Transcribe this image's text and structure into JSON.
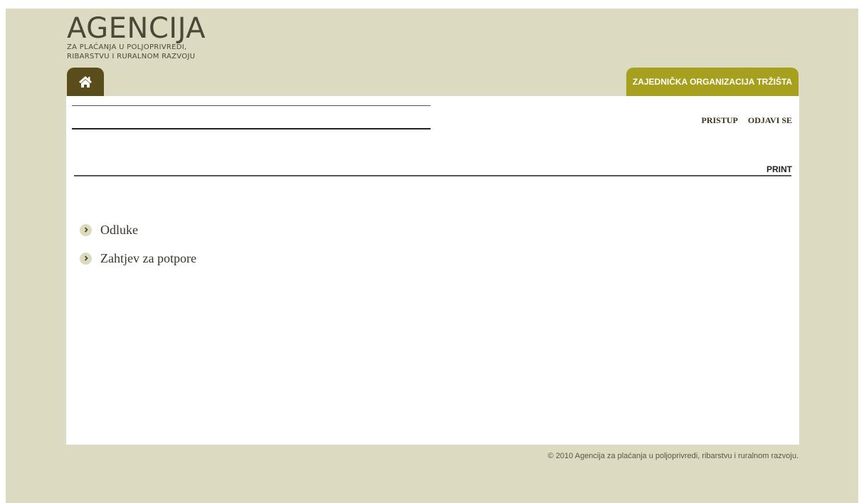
{
  "logo": {
    "title": "AGENCIJA",
    "subtitle_line1": "ZA PLAĆANJA U POLJOPRIVREDI,",
    "subtitle_line2": "RIBARSTVU I RURALNOM RAZVOJU"
  },
  "tabs": {
    "home_icon": "home-icon",
    "section_label": "ZAJEDNIČKA ORGANIZACIJA TRŽIŠTA"
  },
  "topnav": {
    "access_label": "PRISTUP",
    "logout_label": "ODJAVI SE"
  },
  "toolbar": {
    "print_label": "PRINT"
  },
  "menu": {
    "items": [
      {
        "label": "Odluke",
        "icon": "chevron-right-icon"
      },
      {
        "label": "Zahtjev za potpore",
        "icon": "chevron-right-icon"
      }
    ]
  },
  "footer": {
    "copyright": "© 2010 Agencija za plaćanja u poljoprivredi, ribarstvu i ruralnom razvoju."
  },
  "colors": {
    "background": "#dcdbc1",
    "home_tab": "#5b4c1c",
    "section_tab": "#a6a01e",
    "panel": "#ffffff"
  }
}
